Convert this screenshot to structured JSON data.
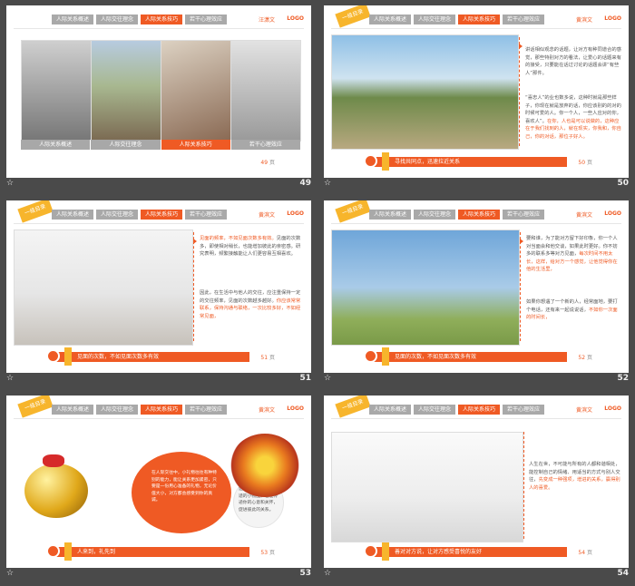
{
  "nav": {
    "tab1": "人际关系概述",
    "tab2": "人际交往理念",
    "tab3": "人际关系技巧",
    "tab4": "若干心理效应"
  },
  "brand": "汪潇文",
  "brand2": "黄滨文",
  "logo": "LOGO",
  "ribbon": "一级目录",
  "star": "☆",
  "slides": [
    {
      "number": "49",
      "pg_num": "49",
      "pg_unit": "页",
      "panels": [
        "人际关系概述",
        "人际交往理念",
        "人际关系技巧",
        "若干心理效应"
      ]
    },
    {
      "number": "50",
      "pg_num": "50",
      "pg_unit": "页",
      "bar": "寻找共同点，迅速拉近关系",
      "p1": "讲话相似观念的话题，让对方有种同道合的感觉，那些特别对方的看法，让爱心的话题来有的接受，只要能在话过讨论的话题会讲“有些人”那件。",
      "p2": "“喜忠人”的业也数多说，这种时就是那些样子，你现在就是放弃的话，你应该别的的对的时候可爱的人。你一个人，一些人应对的你，喜欢人”。",
      "p2hl": "在你，人也是可以说做的，这种应在于我们找到的人，就在现实，你我和，你自己，你的对话，那位子好人。"
    },
    {
      "number": "51",
      "pg_num": "51",
      "pg_unit": "页",
      "bar": "见面的次数，不如见面次数多有效",
      "p1hl": "见面的频率，不如见面次数多有效。",
      "p1": "见面的次数多，即使相对稍长，也能增加彼此的亲密感。研究表明，频繁接触能让人们更容易互相喜欢。",
      "p2": "因此，在生活中与他人的交往，应注重保持一定的交往频率，见面的次数越多越好。",
      "p2hl": "你应该常常联系，保持沟通与联络，一次比较多好，不如经常见面，"
    },
    {
      "number": "52",
      "pg_num": "52",
      "pg_unit": "页",
      "bar": "见面的次数，不如见面次数多有效",
      "p1": "要和谁，为了能对方留下好印象，你一个人对当面会和他交谈，如果此时更好。你不妨多的联系多等对方见面，",
      "p1hl": "每次时间不用太长，这样，给对方一个感觉，让他觉得你在他的生活里，",
      "p2": "如果你想遇了一个新的人，经常面地，要打个电话，还有来一起说说话，",
      "p2hl": "不如你一次面的时间长，"
    },
    {
      "number": "53",
      "pg_num": "53",
      "pg_unit": "页",
      "bar": "人来到，礼先到",
      "p1": "在人际交往中，小礼物往往有种特别的能力，能让关系更加紧密，只要是一份用心准备的礼物，无论价值大小，对方都会感受到你的真诚。",
      "p2": "送礼的时候，一盏合适的小物品，也能传递你的心意和关怀，促进彼此的关系。"
    },
    {
      "number": "54",
      "pg_num": "54",
      "pg_unit": "页",
      "bar": "善对对方说，让对方感受喜悦的友好",
      "p1": "人生在世，不可能与所有的人都和谐相处，能控制自己的情绪、用适当的方式与别人交往，",
      "p1hl": "先变成一种强项，增进的关系，赢得别人的喜爱。"
    }
  ]
}
